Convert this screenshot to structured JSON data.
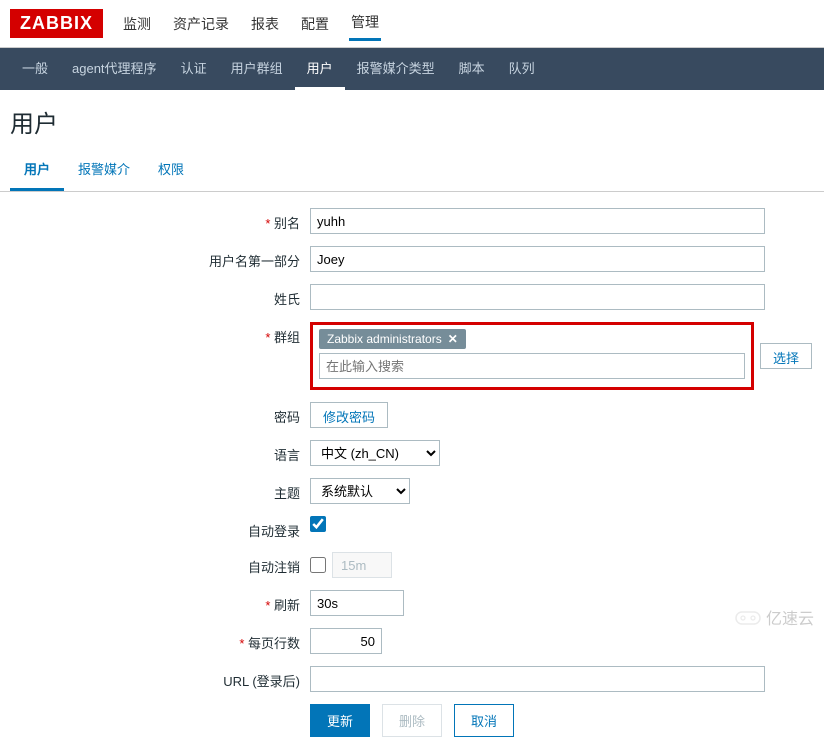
{
  "logo": "ZABBIX",
  "topnav": {
    "items": [
      "监测",
      "资产记录",
      "报表",
      "配置",
      "管理"
    ],
    "active_index": 4
  },
  "subnav": {
    "items": [
      "一般",
      "agent代理程序",
      "认证",
      "用户群组",
      "用户",
      "报警媒介类型",
      "脚本",
      "队列"
    ],
    "active_index": 4
  },
  "page_title": "用户",
  "tabs": {
    "items": [
      "用户",
      "报警媒介",
      "权限"
    ],
    "active_index": 0
  },
  "form": {
    "alias_label": "别名",
    "alias_value": "yuhh",
    "firstname_label": "用户名第一部分",
    "firstname_value": "Joey",
    "lastname_label": "姓氏",
    "lastname_value": "",
    "groups_label": "群组",
    "groups_tag": "Zabbix administrators",
    "groups_placeholder": "在此输入搜索",
    "select_button": "选择",
    "password_label": "密码",
    "password_button": "修改密码",
    "language_label": "语言",
    "language_value": "中文 (zh_CN)",
    "theme_label": "主题",
    "theme_value": "系统默认",
    "autologin_label": "自动登录",
    "autologin_checked": true,
    "autologout_label": "自动注销",
    "autologout_checked": false,
    "autologout_value": "15m",
    "refresh_label": "刷新",
    "refresh_value": "30s",
    "rows_label": "每页行数",
    "rows_value": "50",
    "url_label": "URL (登录后)",
    "url_value": ""
  },
  "buttons": {
    "update": "更新",
    "delete": "删除",
    "cancel": "取消"
  },
  "watermark": "亿速云"
}
